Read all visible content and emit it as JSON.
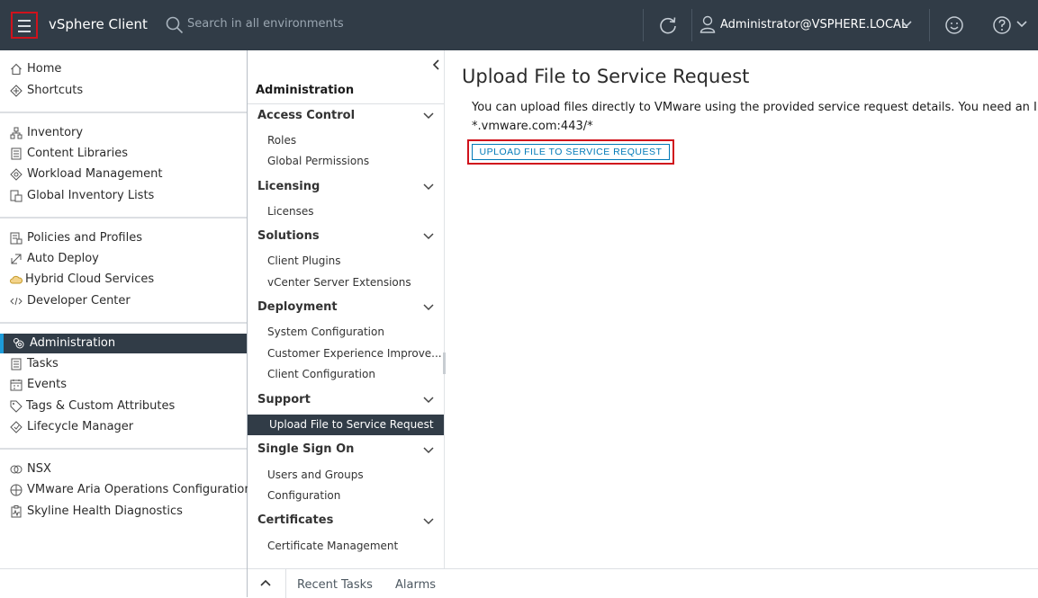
{
  "header": {
    "app_title": "vSphere Client",
    "search_placeholder": "Search in all environments",
    "user": "Administrator@VSPHERE.LOCAL"
  },
  "left_nav": {
    "items": [
      {
        "label": "Home",
        "icon": "home-icon"
      },
      {
        "label": "Shortcuts",
        "icon": "shortcuts-icon"
      },
      {
        "label": "Inventory",
        "icon": "inventory-icon"
      },
      {
        "label": "Content Libraries",
        "icon": "library-icon"
      },
      {
        "label": "Workload Management",
        "icon": "workload-icon"
      },
      {
        "label": "Global Inventory Lists",
        "icon": "global-inventory-icon"
      },
      {
        "label": "Policies and Profiles",
        "icon": "policies-icon"
      },
      {
        "label": "Auto Deploy",
        "icon": "auto-deploy-icon"
      },
      {
        "label": "Hybrid Cloud Services",
        "icon": "cloud-icon"
      },
      {
        "label": "Developer Center",
        "icon": "code-icon"
      },
      {
        "label": "Administration",
        "icon": "administration-icon",
        "active": true
      },
      {
        "label": "Tasks",
        "icon": "tasks-icon"
      },
      {
        "label": "Events",
        "icon": "events-icon"
      },
      {
        "label": "Tags & Custom Attributes",
        "icon": "tag-icon"
      },
      {
        "label": "Lifecycle Manager",
        "icon": "lifecycle-icon"
      },
      {
        "label": "NSX",
        "icon": "nsx-icon"
      },
      {
        "label": "VMware Aria Operations Configuration",
        "icon": "aria-icon"
      },
      {
        "label": "Skyline Health Diagnostics",
        "icon": "skyline-icon"
      }
    ]
  },
  "admin_panel": {
    "title": "Administration",
    "sections": [
      {
        "label": "Access Control",
        "items": [
          "Roles",
          "Global Permissions"
        ]
      },
      {
        "label": "Licensing",
        "items": [
          "Licenses"
        ]
      },
      {
        "label": "Solutions",
        "items": [
          "Client Plugins",
          "vCenter Server Extensions"
        ]
      },
      {
        "label": "Deployment",
        "items": [
          "System Configuration",
          "Customer Experience Improve...",
          "Client Configuration"
        ]
      },
      {
        "label": "Support",
        "items": [
          "Upload File to Service Request"
        ]
      },
      {
        "label": "Single Sign On",
        "items": [
          "Users and Groups",
          "Configuration"
        ]
      },
      {
        "label": "Certificates",
        "items": [
          "Certificate Management"
        ]
      }
    ]
  },
  "main": {
    "title": "Upload File to Service Request",
    "description_line1": "You can upload files directly to VMware using the provided service request details. You need an Internet",
    "description_line2": "*.vmware.com:443/*",
    "upload_button": "UPLOAD FILE TO SERVICE REQUEST"
  },
  "bottom_bar": {
    "recent_tasks": "Recent Tasks",
    "alarms": "Alarms"
  },
  "colors": {
    "header_bg": "#313c47",
    "accent_blue": "#0079b8",
    "highlight_red": "#d0121c",
    "active_bar": "#1d9bd9"
  }
}
